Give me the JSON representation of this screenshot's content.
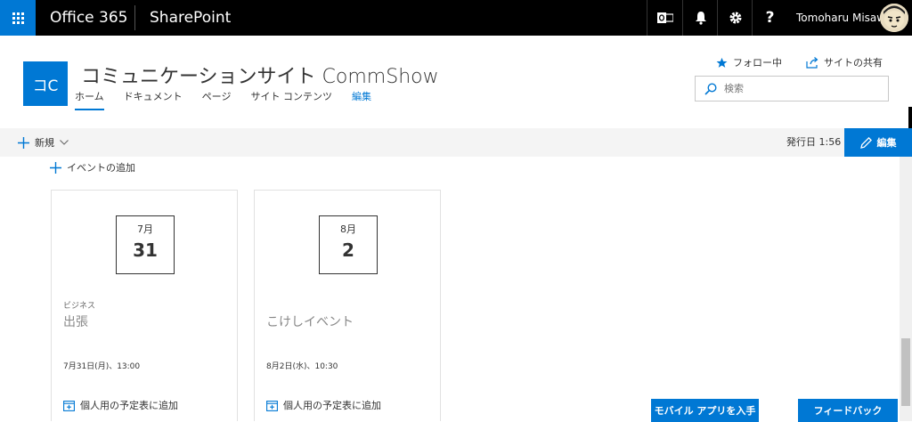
{
  "suitebar": {
    "brand": "Office 365",
    "app": "SharePoint",
    "help_label": "?",
    "user_name": "Tomoharu Misawa"
  },
  "site": {
    "logo_text": "コC",
    "title": "コミュニケーションサイト CommShow",
    "nav": [
      "ホーム",
      "ドキュメント",
      "ページ",
      "サイト コンテンツ",
      "編集"
    ],
    "follow_label": "フォロー中",
    "share_label": "サイトの共有",
    "search_placeholder": "検索"
  },
  "commandbar": {
    "new_label": "新規",
    "published_label": "発行日 1:56",
    "edit_label": "編集"
  },
  "events": {
    "add_label": "イベントの追加",
    "cards": [
      {
        "month": "7月",
        "day": "31",
        "category": "ビジネス",
        "title": "出張",
        "time": "7月31日(月)、13:00",
        "calendar_label": "個人用の予定表に追加"
      },
      {
        "month": "8月",
        "day": "2",
        "category": "",
        "title": "こけしイベント",
        "time": "8月2日(水)、10:30",
        "calendar_label": "個人用の予定表に追加"
      }
    ]
  },
  "footer": {
    "mobile_label": "モバイル アプリを入手",
    "feedback_label": "フィードバック"
  },
  "colors": {
    "accent": "#0078d4",
    "suitebar": "#000000",
    "commandbar": "#f4f4f4"
  }
}
